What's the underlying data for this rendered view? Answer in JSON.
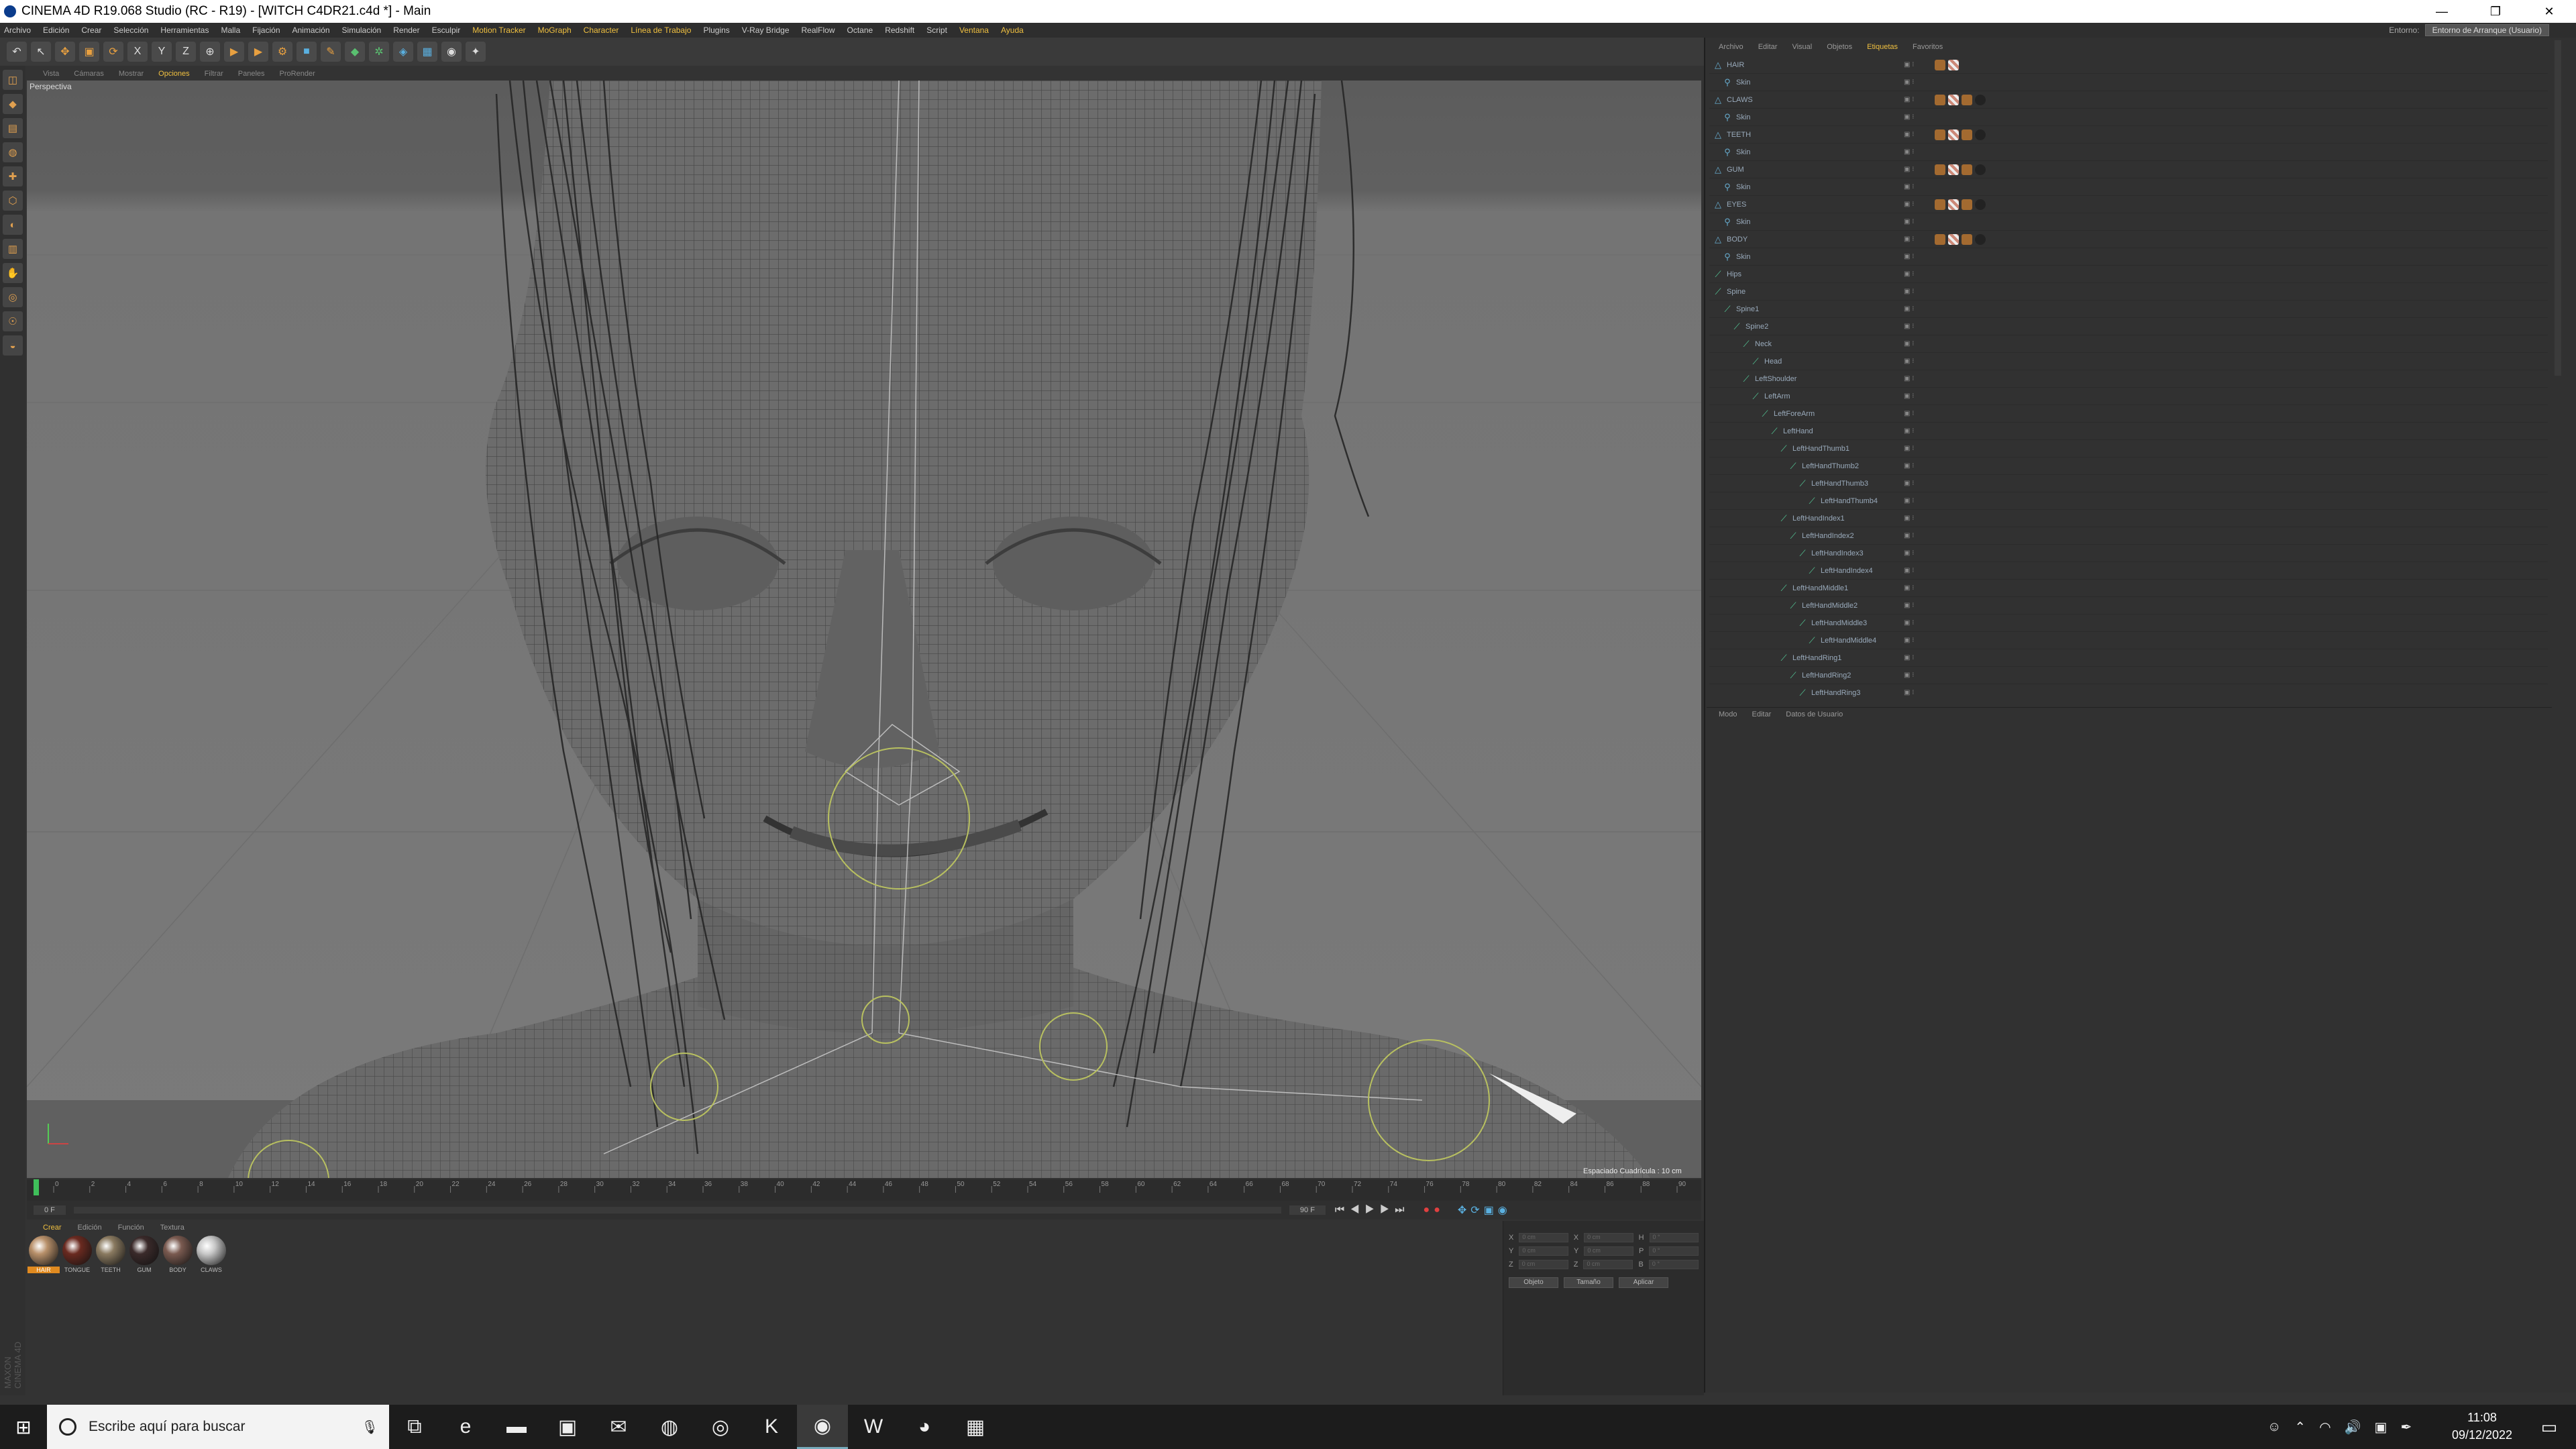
{
  "window": {
    "title": "CINEMA 4D R19.068 Studio (RC - R19) - [WITCH C4DR21.c4d *] - Main",
    "minimize": "—",
    "maximize": "❐",
    "close": "✕"
  },
  "menubar": {
    "items": [
      "Archivo",
      "Edición",
      "Crear",
      "Selección",
      "Herramientas",
      "Malla",
      "Fijación",
      "Animación",
      "Simulación",
      "Render",
      "Esculpir",
      "Motion Tracker",
      "MoGraph",
      "Character",
      "Línea de Trabajo",
      "Plugins",
      "V-Ray Bridge",
      "RealFlow",
      "Octane",
      "Redshift",
      "Script",
      "Ventana",
      "Ayuda"
    ],
    "layout_label": "Entorno:",
    "layout_value": "Entorno de Arranque (Usuario)"
  },
  "toolbar": {
    "buttons": [
      {
        "icon": "undo-icon",
        "glyph": "↶",
        "color": "plain"
      },
      {
        "icon": "live-select-icon",
        "glyph": "↖",
        "color": "plain"
      },
      {
        "icon": "move-icon",
        "glyph": "✥",
        "color": "or"
      },
      {
        "icon": "scale-icon",
        "glyph": "▣",
        "color": "or"
      },
      {
        "icon": "rotate-icon",
        "glyph": "⟳",
        "color": "or"
      },
      {
        "icon": "axis-x-icon",
        "glyph": "X",
        "color": "plain"
      },
      {
        "icon": "axis-y-icon",
        "glyph": "Y",
        "color": "plain"
      },
      {
        "icon": "axis-z-icon",
        "glyph": "Z",
        "color": "plain"
      },
      {
        "icon": "coordinate-system-icon",
        "glyph": "⊕",
        "color": "plain"
      },
      {
        "icon": "render-view-icon",
        "glyph": "▶",
        "color": "or"
      },
      {
        "icon": "render-picture-viewer-icon",
        "glyph": "▶",
        "color": "or"
      },
      {
        "icon": "render-settings-icon",
        "glyph": "⚙",
        "color": "or"
      },
      {
        "icon": "cube-icon",
        "glyph": "■",
        "color": "bl"
      },
      {
        "icon": "spline-pen-icon",
        "glyph": "✎",
        "color": "or"
      },
      {
        "icon": "subdivision-icon",
        "glyph": "◆",
        "color": "gr"
      },
      {
        "icon": "array-icon",
        "glyph": "✲",
        "color": "gr"
      },
      {
        "icon": "deformer-icon",
        "glyph": "◈",
        "color": "bl"
      },
      {
        "icon": "floor-icon",
        "glyph": "▦",
        "color": "bl"
      },
      {
        "icon": "camera-icon",
        "glyph": "◉",
        "color": "plain"
      },
      {
        "icon": "light-icon",
        "glyph": "✦",
        "color": "plain"
      }
    ]
  },
  "left_tools": [
    "◫",
    "◆",
    "▤",
    "◍",
    "✚",
    "⬡",
    "◐",
    "▥",
    "✋",
    "◎",
    "☉",
    "◒"
  ],
  "viewport": {
    "menu": [
      "Vista",
      "Cámaras",
      "Mostrar",
      "Opciones",
      "Filtrar",
      "Paneles",
      "ProRender"
    ],
    "active_menu": "Opciones",
    "camera_label": "Perspectiva",
    "grid_scale": "Espaciado Cuadrícula : 10 cm"
  },
  "timeline": {
    "ticks": [
      "0",
      "2",
      "4",
      "6",
      "8",
      "10",
      "12",
      "14",
      "16",
      "18",
      "20",
      "22",
      "24",
      "26",
      "28",
      "30",
      "32",
      "34",
      "36",
      "38",
      "40",
      "42",
      "44",
      "46",
      "48",
      "50",
      "52",
      "54",
      "56",
      "58",
      "60",
      "62",
      "64",
      "66",
      "68",
      "70",
      "72",
      "74",
      "76",
      "78",
      "80",
      "82",
      "84",
      "86",
      "88",
      "90"
    ],
    "start_frame": "0 F",
    "end_frame": "90 F",
    "current_frame": "0 F"
  },
  "materials": {
    "menu": [
      "Crear",
      "Edición",
      "Función",
      "Textura"
    ],
    "items": [
      {
        "label": "HAIR",
        "color": "#b8906a",
        "selected": true
      },
      {
        "label": "TONGUE",
        "color": "#6a2a20",
        "selected": false
      },
      {
        "label": "TEETH",
        "color": "#8a7a60",
        "selected": false
      },
      {
        "label": "GUM",
        "color": "#3a2a2a",
        "selected": false
      },
      {
        "label": "BODY",
        "color": "#7a5a50",
        "selected": false
      },
      {
        "label": "CLAWS",
        "color": "#c8c8c8",
        "selected": false
      }
    ]
  },
  "coords": {
    "rows": [
      {
        "a": "X",
        "av": "0 cm",
        "b": "X",
        "bv": "0 cm",
        "c": "H",
        "cv": "0 °"
      },
      {
        "a": "Y",
        "av": "0 cm",
        "b": "Y",
        "bv": "0 cm",
        "c": "P",
        "cv": "0 °"
      },
      {
        "a": "Z",
        "av": "0 cm",
        "b": "Z",
        "bv": "0 cm",
        "c": "B",
        "cv": "0 °"
      }
    ],
    "mode1": "Objeto",
    "mode2": "Tamaño",
    "apply": "Aplicar"
  },
  "object_manager": {
    "menu": [
      "Archivo",
      "Editar",
      "Visual",
      "Objetos",
      "Etiquetas",
      "Favoritos"
    ],
    "objects": [
      {
        "name": "HAIR",
        "indent": 0,
        "type": "mesh",
        "tags": [
          "or",
          "chk"
        ]
      },
      {
        "name": "Skin",
        "indent": 1,
        "type": "skin",
        "tags": []
      },
      {
        "name": "CLAWS",
        "indent": 0,
        "type": "mesh",
        "tags": [
          "or",
          "chk",
          "or",
          "sph"
        ]
      },
      {
        "name": "Skin",
        "indent": 1,
        "type": "skin",
        "tags": []
      },
      {
        "name": "TEETH",
        "indent": 0,
        "type": "mesh",
        "tags": [
          "or",
          "chk",
          "or",
          "sph"
        ]
      },
      {
        "name": "Skin",
        "indent": 1,
        "type": "skin",
        "tags": []
      },
      {
        "name": "GUM",
        "indent": 0,
        "type": "mesh",
        "tags": [
          "or",
          "chk",
          "or",
          "sph"
        ]
      },
      {
        "name": "Skin",
        "indent": 1,
        "type": "skin",
        "tags": []
      },
      {
        "name": "EYES",
        "indent": 0,
        "type": "mesh",
        "tags": [
          "or",
          "chk",
          "or",
          "sph"
        ]
      },
      {
        "name": "Skin",
        "indent": 1,
        "type": "skin",
        "tags": []
      },
      {
        "name": "BODY",
        "indent": 0,
        "type": "mesh",
        "tags": [
          "or",
          "chk",
          "or",
          "sph"
        ]
      },
      {
        "name": "Skin",
        "indent": 1,
        "type": "skin",
        "tags": []
      },
      {
        "name": "Hips",
        "indent": 0,
        "type": "bone",
        "tags": []
      },
      {
        "name": "Spine",
        "indent": 0,
        "type": "bone",
        "tags": []
      },
      {
        "name": "Spine1",
        "indent": 1,
        "type": "bone",
        "tags": []
      },
      {
        "name": "Spine2",
        "indent": 2,
        "type": "bone",
        "tags": []
      },
      {
        "name": "Neck",
        "indent": 3,
        "type": "bone",
        "tags": []
      },
      {
        "name": "Head",
        "indent": 4,
        "type": "bone",
        "tags": []
      },
      {
        "name": "LeftShoulder",
        "indent": 3,
        "type": "bone",
        "tags": []
      },
      {
        "name": "LeftArm",
        "indent": 4,
        "type": "bone",
        "tags": []
      },
      {
        "name": "LeftForeArm",
        "indent": 5,
        "type": "bone",
        "tags": []
      },
      {
        "name": "LeftHand",
        "indent": 6,
        "type": "bone",
        "tags": []
      },
      {
        "name": "LeftHandThumb1",
        "indent": 7,
        "type": "bone",
        "tags": []
      },
      {
        "name": "LeftHandThumb2",
        "indent": 8,
        "type": "bone",
        "tags": []
      },
      {
        "name": "LeftHandThumb3",
        "indent": 9,
        "type": "bone",
        "tags": []
      },
      {
        "name": "LeftHandThumb4",
        "indent": 10,
        "type": "bone",
        "tags": []
      },
      {
        "name": "LeftHandIndex1",
        "indent": 7,
        "type": "bone",
        "tags": []
      },
      {
        "name": "LeftHandIndex2",
        "indent": 8,
        "type": "bone",
        "tags": []
      },
      {
        "name": "LeftHandIndex3",
        "indent": 9,
        "type": "bone",
        "tags": []
      },
      {
        "name": "LeftHandIndex4",
        "indent": 10,
        "type": "bone",
        "tags": []
      },
      {
        "name": "LeftHandMiddle1",
        "indent": 7,
        "type": "bone",
        "tags": []
      },
      {
        "name": "LeftHandMiddle2",
        "indent": 8,
        "type": "bone",
        "tags": []
      },
      {
        "name": "LeftHandMiddle3",
        "indent": 9,
        "type": "bone",
        "tags": []
      },
      {
        "name": "LeftHandMiddle4",
        "indent": 10,
        "type": "bone",
        "tags": []
      },
      {
        "name": "LeftHandRing1",
        "indent": 7,
        "type": "bone",
        "tags": []
      },
      {
        "name": "LeftHandRing2",
        "indent": 8,
        "type": "bone",
        "tags": []
      },
      {
        "name": "LeftHandRing3",
        "indent": 9,
        "type": "bone",
        "tags": []
      }
    ]
  },
  "attributes": {
    "menu": [
      "Modo",
      "Editar",
      "Datos de Usuario"
    ]
  },
  "taskbar": {
    "search_placeholder": "Escribe aquí para buscar",
    "apps": [
      {
        "name": "task-view-icon",
        "glyph": "⧉"
      },
      {
        "name": "edge-icon",
        "glyph": "e"
      },
      {
        "name": "file-explorer-icon",
        "glyph": "▬"
      },
      {
        "name": "store-icon",
        "glyph": "▣"
      },
      {
        "name": "mail-icon",
        "glyph": "✉"
      },
      {
        "name": "firefox-icon",
        "glyph": "◍"
      },
      {
        "name": "app-red-icon",
        "glyph": "◎"
      },
      {
        "name": "k-app-icon",
        "glyph": "K"
      },
      {
        "name": "cinema4d-icon",
        "glyph": "◉",
        "active": true
      },
      {
        "name": "word-icon",
        "glyph": "W"
      },
      {
        "name": "chrome-icon",
        "glyph": "◕"
      },
      {
        "name": "winrar-icon",
        "glyph": "▦"
      }
    ],
    "time": "11:08",
    "date": "09/12/2022"
  }
}
